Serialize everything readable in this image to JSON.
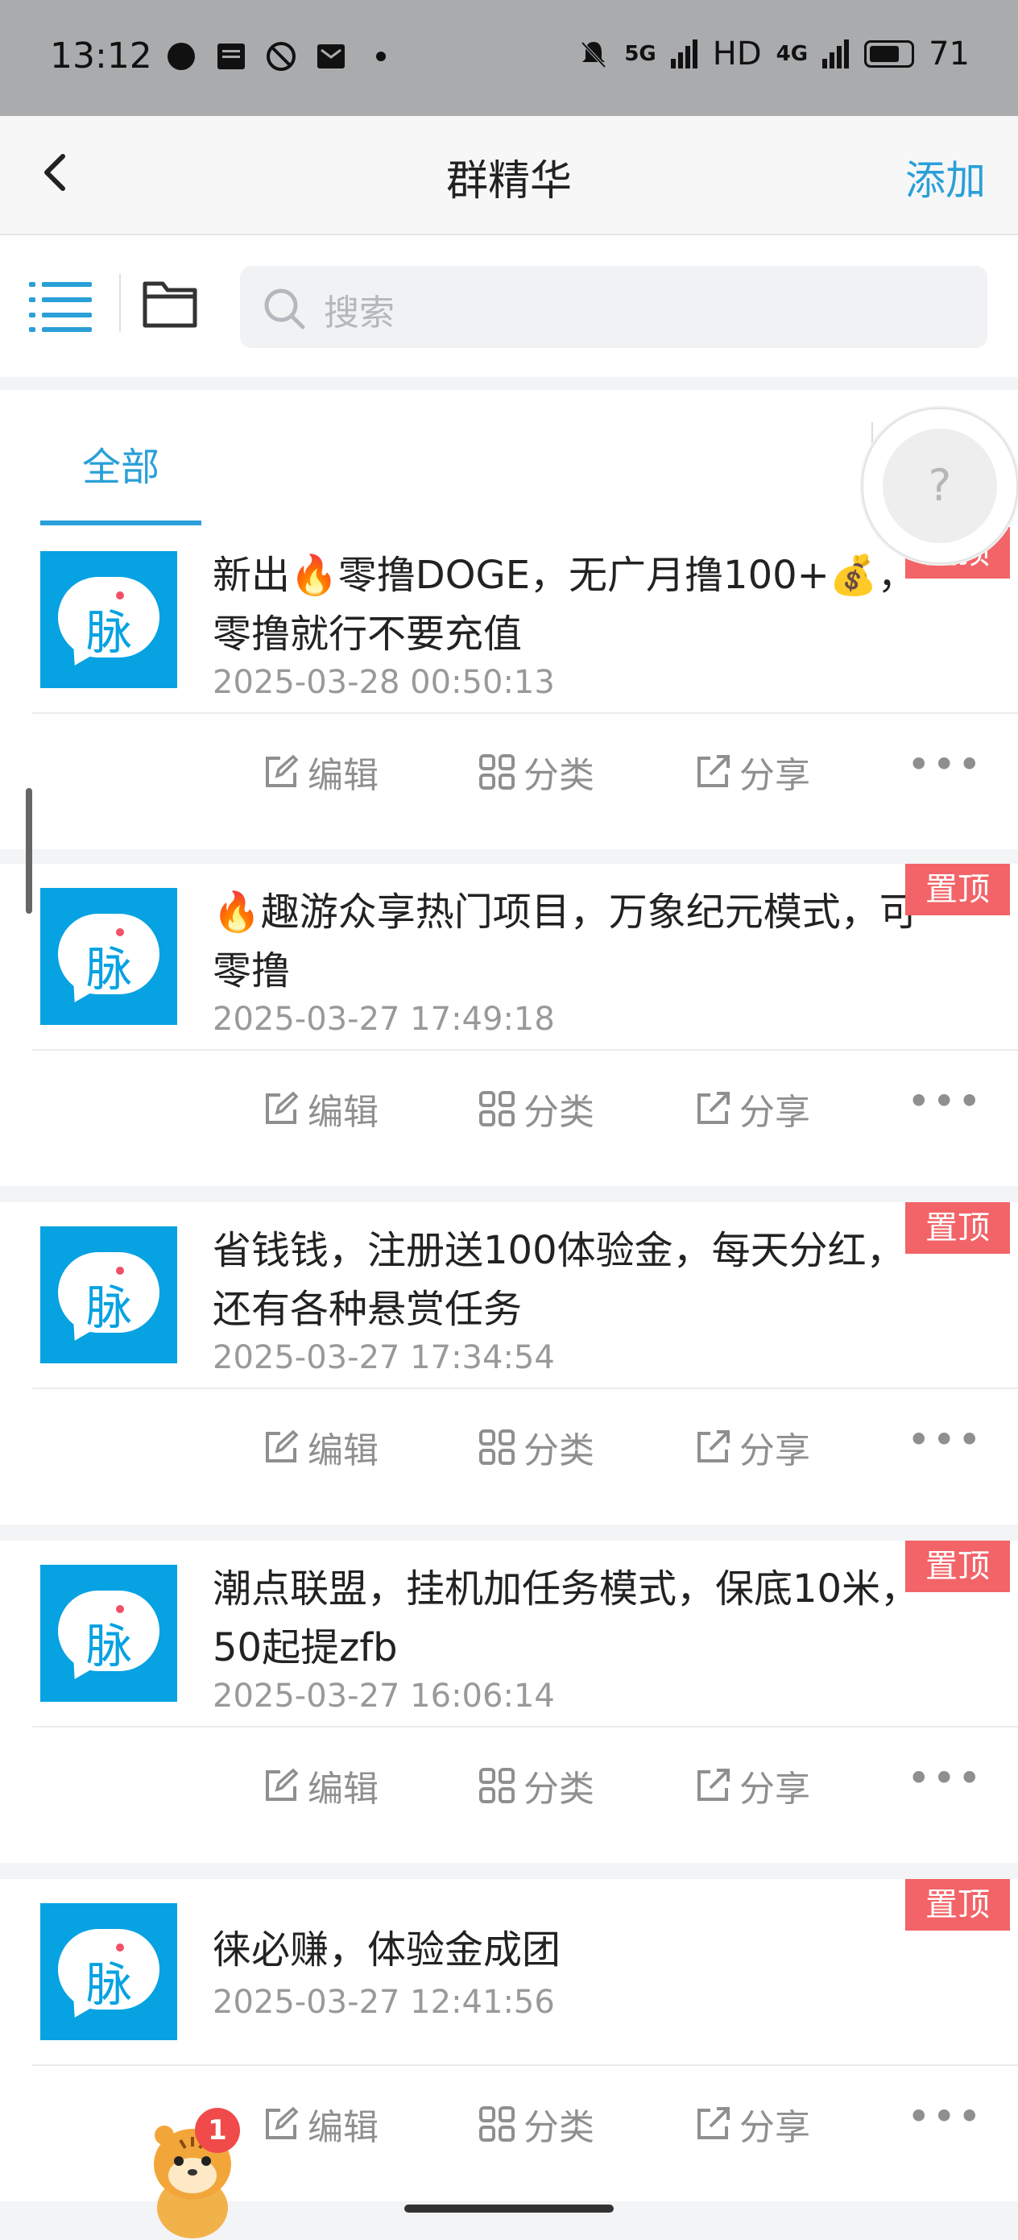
{
  "status_bar": {
    "time": "13:12",
    "battery": "71",
    "sig1": "5G",
    "hd": "HD",
    "sig2": "4G"
  },
  "nav": {
    "title": "群精华",
    "add_label": "添加"
  },
  "search": {
    "placeholder": "搜索"
  },
  "tabs": {
    "all_label": "全部",
    "help": "?"
  },
  "actions": {
    "edit": "编辑",
    "category": "分类",
    "share": "分享",
    "more": "•••"
  },
  "avatar_char": "脉",
  "pin_label": "置顶",
  "posts": [
    {
      "title": "新出🔥零撸DOGE，无广月撸100+💰，零撸就行不要充值",
      "time": "2025-03-28 00:50:13"
    },
    {
      "title": "🔥趣游众享热门项目，万象纪元模式，可零撸",
      "time": "2025-03-27 17:49:18"
    },
    {
      "title": "省钱钱，注册送100体验金，每天分红，还有各种悬赏任务",
      "time": "2025-03-27 17:34:54"
    },
    {
      "title": "潮点联盟，挂机加任务模式，保底10米，50起提zfb",
      "time": "2025-03-27 16:06:14"
    },
    {
      "title": "徕必赚，体验金成团",
      "time": "2025-03-27 12:41:56"
    }
  ],
  "badge_count": "1",
  "colors": {
    "accent": "#2a9fd8",
    "pin": "#f26468",
    "avatar_bg": "#06a2e2"
  }
}
